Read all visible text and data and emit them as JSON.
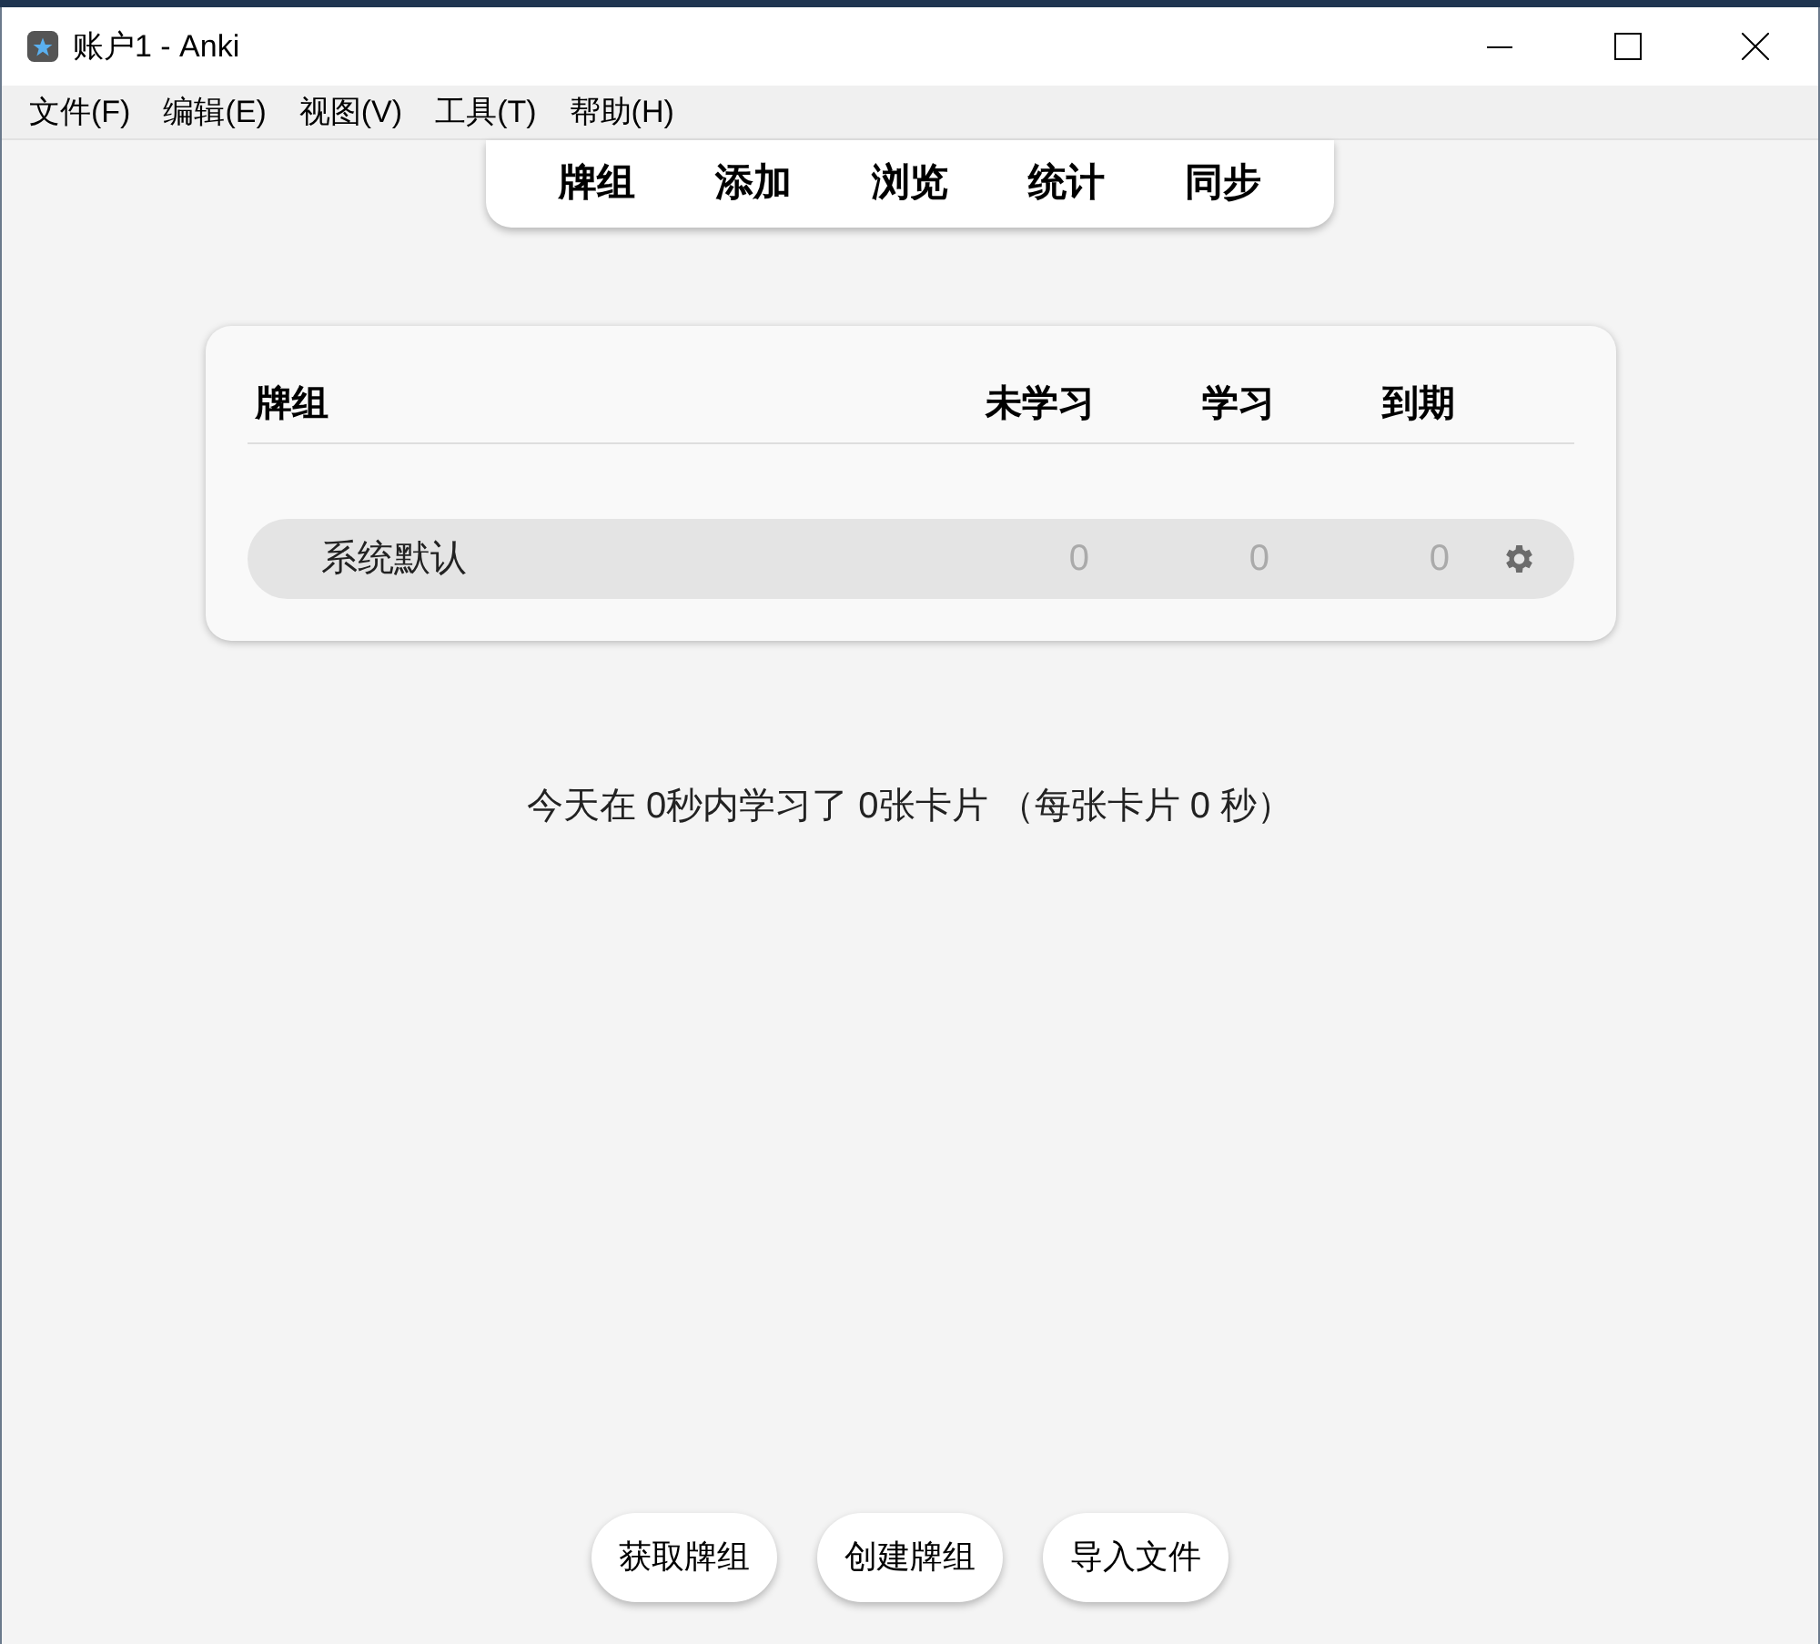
{
  "window": {
    "title": "账户1 - Anki"
  },
  "menu": [
    "文件(F)",
    "编辑(E)",
    "视图(V)",
    "工具(T)",
    "帮助(H)"
  ],
  "toolbar": [
    "牌组",
    "添加",
    "浏览",
    "统计",
    "同步"
  ],
  "deck_table": {
    "columns": [
      "牌组",
      "未学习",
      "学习",
      "到期"
    ],
    "rows": [
      {
        "name": "系统默认",
        "new": "0",
        "learn": "0",
        "due": "0"
      }
    ]
  },
  "study_summary": "今天在 0秒内学习了 0张卡片 （每张卡片 0 秒）",
  "buttons": [
    "获取牌组",
    "创建牌组",
    "导入文件"
  ]
}
